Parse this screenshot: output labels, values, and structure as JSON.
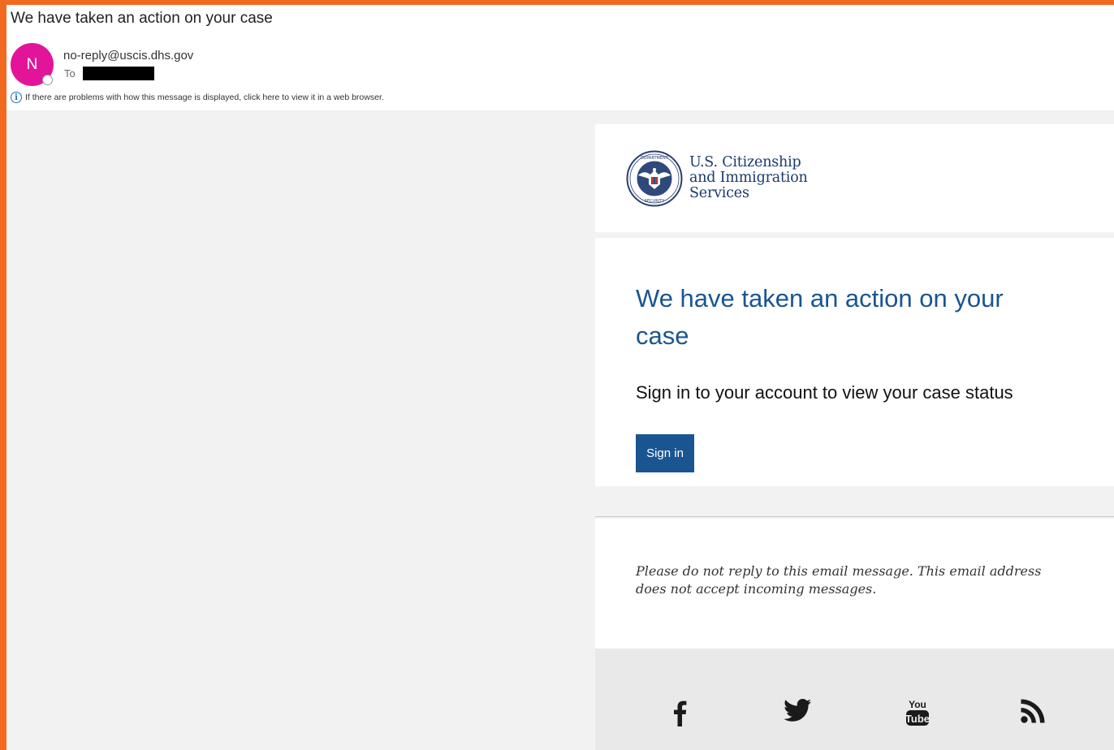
{
  "email": {
    "subject": "We have taken an action on your case",
    "sender_initial": "N",
    "sender": "no-reply@uscis.dhs.gov",
    "to_label": "To",
    "info_text": "If there are problems with how this message is displayed, click here to view it in a web browser."
  },
  "message": {
    "org_name_line1": "U.S. Citizenship",
    "org_name_line2": "and Immigration",
    "org_name_line3": "Services",
    "headline": "We have taken an action on your case",
    "subline": "Sign in to your account to view your case status",
    "signin_label": "Sign in",
    "note": "Please do not reply to this email message. This email address does not accept incoming messages."
  },
  "social": [
    "facebook-icon",
    "twitter-icon",
    "youtube-icon",
    "rss-icon"
  ],
  "colors": {
    "frame_border": "#f26a1f",
    "avatar": "#e2159a",
    "brand_blue": "#1a5591",
    "canvas": "#f2f2f2",
    "footer": "#e9e9e9"
  }
}
